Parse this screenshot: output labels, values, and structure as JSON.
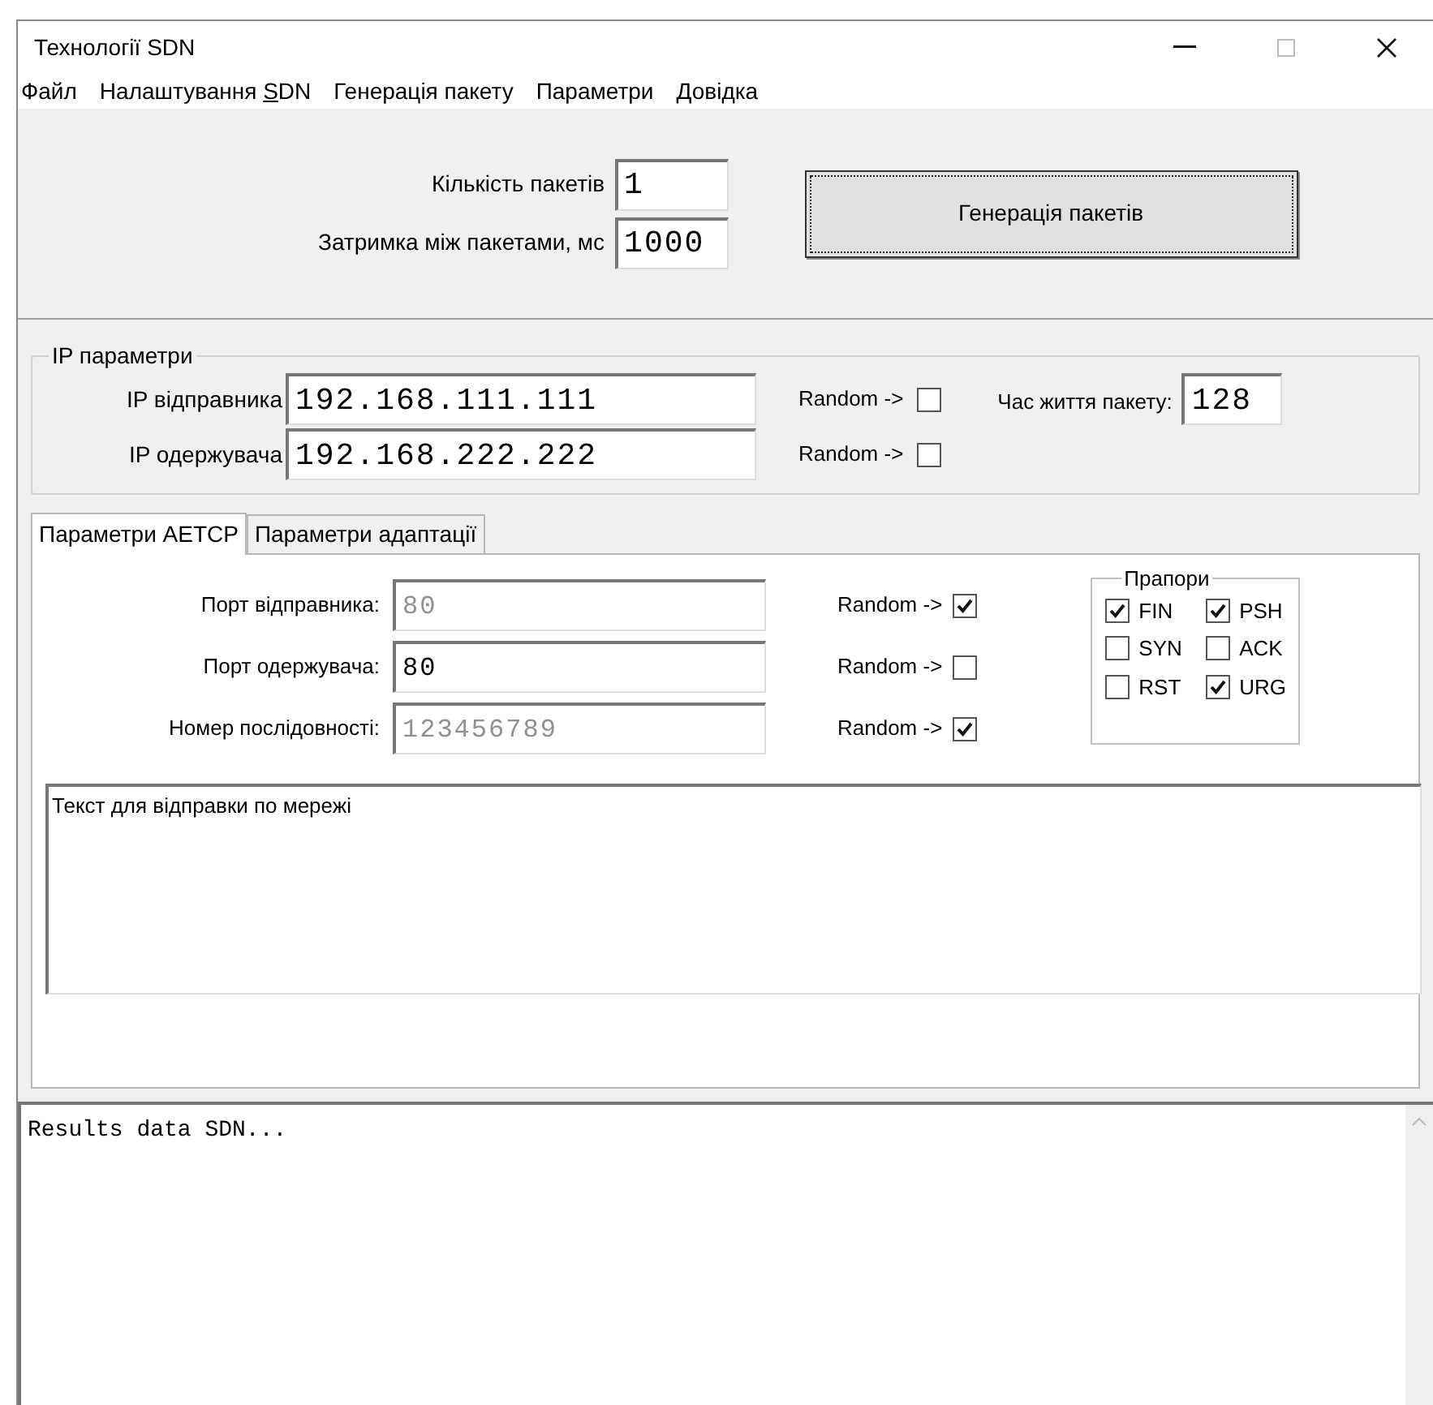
{
  "window": {
    "title": "Технології SDN"
  },
  "menu": [
    {
      "label": "Файл"
    },
    {
      "label": "Налаштування ",
      "underlined": "S",
      "rest": "DN"
    },
    {
      "label": "Генерація пакету"
    },
    {
      "label": "Параметри"
    },
    {
      "label": "Довідка"
    }
  ],
  "generation": {
    "count_label": "Кількість пакетів",
    "count_value": "1",
    "delay_label": "Затримка між пакетами, мс",
    "delay_value": "1000",
    "button": "Генерація пакетів"
  },
  "ip_group": {
    "title": "IP параметри",
    "rows": [
      {
        "label": "IP відправника",
        "value": "192.168.111.111",
        "random_label": "Random ->",
        "random_checked": false
      },
      {
        "label": "IP одержувача",
        "value": "192.168.222.222",
        "random_label": "Random ->",
        "random_checked": false
      }
    ],
    "ttl_label": "Час життя пакету:",
    "ttl_value": "128"
  },
  "tabs": [
    {
      "label": "Параметри AETCP",
      "selected": true
    },
    {
      "label": "Параметри адаптації",
      "selected": false
    }
  ],
  "tcp_fields": [
    {
      "label": "Порт відправника:",
      "value": "80",
      "disabled": true,
      "random_label": "Random ->",
      "random_checked": true
    },
    {
      "label": "Порт одержувача:",
      "value": "80",
      "disabled": false,
      "random_label": "Random ->",
      "random_checked": false
    },
    {
      "label": "Номер послідовності:",
      "value": "123456789",
      "disabled": true,
      "random_label": "Random ->",
      "random_checked": true
    }
  ],
  "flags": {
    "title": "Прапори",
    "items": [
      {
        "label": "FIN",
        "checked": true
      },
      {
        "label": "PSH",
        "checked": true
      },
      {
        "label": "SYN",
        "checked": false
      },
      {
        "label": "ACK",
        "checked": false
      },
      {
        "label": "RST",
        "checked": false
      },
      {
        "label": "URG",
        "checked": true
      }
    ]
  },
  "message": {
    "value": "Текст для відправки по мережі"
  },
  "results": {
    "value": "Results data SDN..."
  }
}
